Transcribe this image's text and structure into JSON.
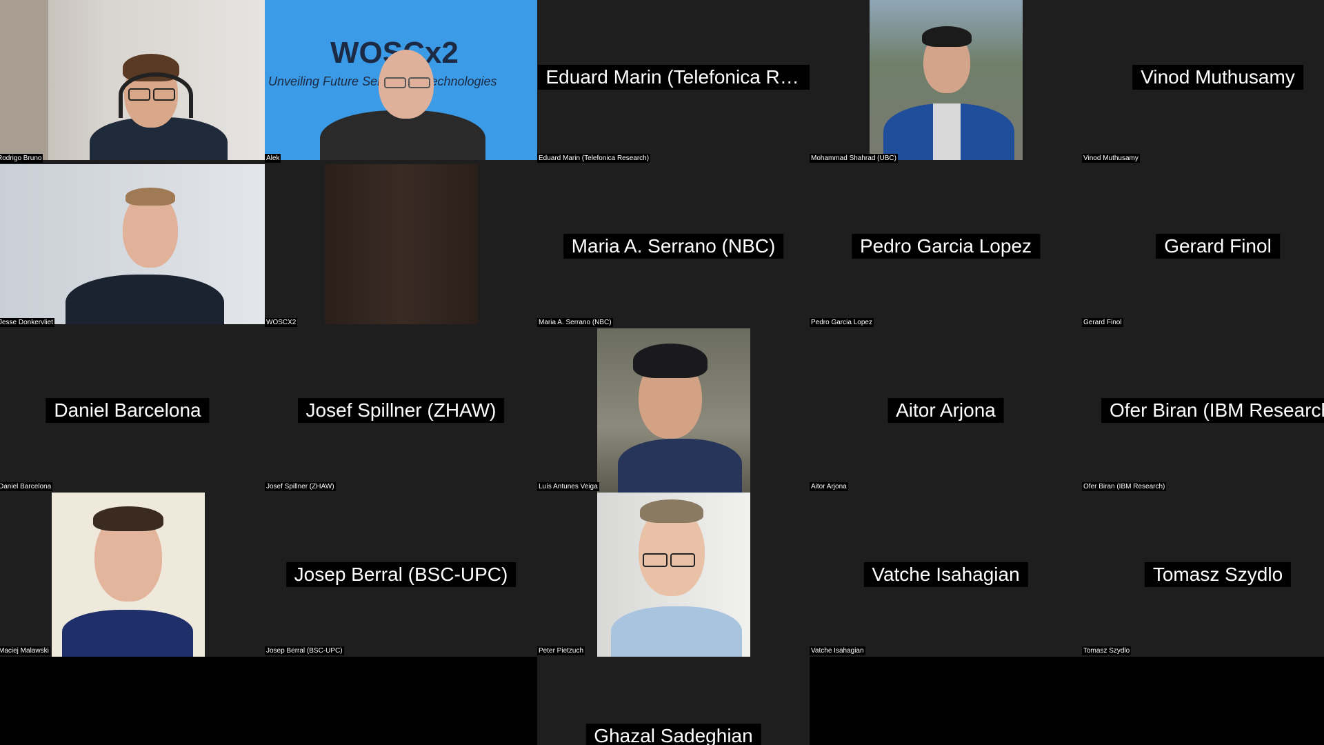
{
  "participants": [
    {
      "display_name": "",
      "label": "Rodrigo Bruno"
    },
    {
      "display_name": "",
      "label": "Alek",
      "brand": "WOSCx2",
      "subtitle": "Unveiling Future Serverless Technologies"
    },
    {
      "display_name": "Eduard Marin (Telefonica Res...",
      "label": "Eduard Marin (Telefonica Research)"
    },
    {
      "display_name": "",
      "label": "Mohammad Shahrad (UBC)"
    },
    {
      "display_name": "Vinod Muthusamy",
      "label": "Vinod Muthusamy"
    },
    {
      "display_name": "",
      "label": "Jesse Donkervliet"
    },
    {
      "display_name": "",
      "label": "WOSCX2"
    },
    {
      "display_name": "Maria A. Serrano (NBC)",
      "label": "Maria A. Serrano (NBC)"
    },
    {
      "display_name": "Pedro Garcia Lopez",
      "label": "Pedro Garcia Lopez"
    },
    {
      "display_name": "Gerard Finol",
      "label": "Gerard Finol"
    },
    {
      "display_name": "Daniel Barcelona",
      "label": "Daniel Barcelona"
    },
    {
      "display_name": "Josef Spillner (ZHAW)",
      "label": "Josef Spillner (ZHAW)"
    },
    {
      "display_name": "",
      "label": "Luís Antunes Veiga"
    },
    {
      "display_name": "Aitor Arjona",
      "label": "Aitor Arjona"
    },
    {
      "display_name": "Ofer Biran (IBM Research)",
      "label": "Ofer Biran (IBM Research)"
    },
    {
      "display_name": "",
      "label": "Maciej Malawski"
    },
    {
      "display_name": "Josep Berral (BSC-UPC)",
      "label": "Josep Berral (BSC-UPC)"
    },
    {
      "display_name": "",
      "label": "Peter Pietzuch"
    },
    {
      "display_name": "Vatche Isahagian",
      "label": "Vatche Isahagian"
    },
    {
      "display_name": "Tomasz Szydlo",
      "label": "Tomasz Szydlo"
    },
    {
      "display_name": "Ghazal Sadeghian",
      "label": ""
    }
  ]
}
